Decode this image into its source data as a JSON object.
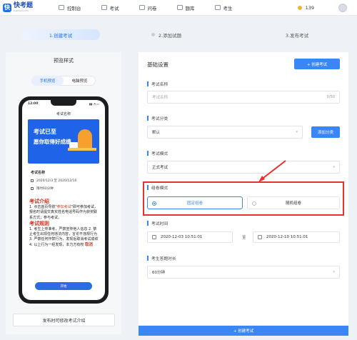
{
  "topbar": {
    "logo_text": "快考题",
    "logo_sub": "kuaikaoti.com",
    "nav": [
      "控制台",
      "考试",
      "问卷",
      "题库",
      "考生"
    ],
    "coins": "139"
  },
  "steps": [
    "1.创建考试",
    "2.添加试题",
    "3.发布考试"
  ],
  "preview": {
    "title": "预览样式",
    "toggle": [
      "手机预览",
      "电脑预览"
    ],
    "phone": {
      "time": "12:00",
      "header": "考试名称",
      "banner_line1": "考试已至",
      "banner_line2": "愿你取得好成绩",
      "card_name": "考试名称",
      "date_range": "2020/12/3 至 2020/12/10",
      "duration": "限时60分钟",
      "intro_title": "考试介绍",
      "intro_text1": "1. 点击首页导航\"",
      "intro_highlight": "参加考试",
      "intro_text2": "\"即可参加考试，报名时请提交真实姓名电话号码作为获奖联系方式；参与考试。",
      "rules_title": "考试规则",
      "rules_text": "1. 考生上传准考，严禁宣传他人信息 2. 禁止考生出现任何违法内容，言论不违规行为 3. 严禁任何作弊行为，发现后取消考试成绩 4. 以上行为一经发现，本力方有权",
      "rules_tag": "取消",
      "start_btn": "开始"
    },
    "edit_intro": "发布时可修改考试介绍"
  },
  "settings": {
    "title": "基础设置",
    "create_btn": "+ 创建考试",
    "exam_name_label": "考试名称",
    "exam_name_placeholder": "考试名称",
    "exam_name_counter": "0/50",
    "category_label": "考试分类",
    "category_value": "默认",
    "add_category": "添加分类",
    "mode_label": "考试模式",
    "mode_value": "正式考试",
    "paper_mode_label": "组卷模式",
    "paper_fixed": "固定组卷",
    "paper_random": "随机组卷",
    "time_label": "考试时间",
    "start_time": "2020-12-03 10:51:01",
    "time_sep": "至",
    "end_time": "2020-12-10 10:51:01",
    "answer_time_label": "考生答题时长",
    "answer_time_value": "60分钟"
  },
  "bottom": {
    "create_btn": "+ 创建考试"
  },
  "colors": {
    "accent": "#3a86f5",
    "highlight": "#e5322d",
    "brand": "#1f6fe5"
  }
}
